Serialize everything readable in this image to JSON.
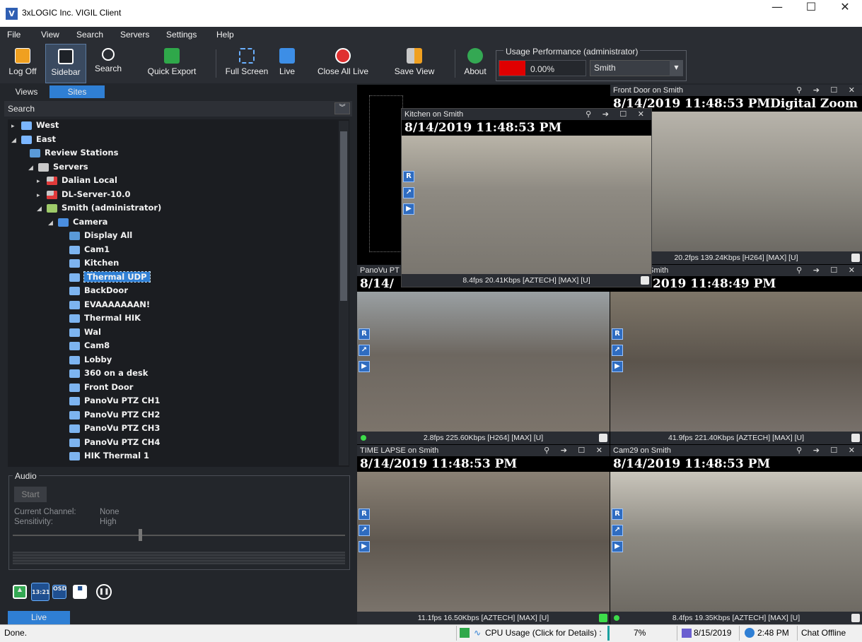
{
  "window": {
    "title": "3xLOGIC Inc. VIGIL Client",
    "icon_letter": "V",
    "minimize": "—",
    "maximize": "☐",
    "close": "✕"
  },
  "menu": [
    "File",
    "View",
    "Search",
    "Servers",
    "Settings",
    "Help"
  ],
  "toolbar": {
    "log_off": "Log Off",
    "sidebar": "Sidebar",
    "search": "Search",
    "quick_export": "Quick Export",
    "full_screen": "Full Screen",
    "live": "Live",
    "close_all_live": "Close All Live",
    "save_view": "Save View",
    "about": "About"
  },
  "usage": {
    "title": "Usage Performance (administrator)",
    "percent": "0.00%",
    "level": 0.0,
    "server": "Smith"
  },
  "left_tabs": {
    "views": "Views",
    "sites": "Sites"
  },
  "search_label": "Search",
  "tree": [
    {
      "label": "West",
      "arrow": "▸",
      "icon": "site-icon"
    },
    {
      "label": "East",
      "arrow": "◢",
      "icon": "site-icon"
    },
    {
      "label": "Review Stations",
      "arrow": "",
      "icon": "review-stations-icon"
    },
    {
      "label": "Servers",
      "arrow": "◢",
      "icon": "servers-icon"
    },
    {
      "label": "Dalian Local",
      "arrow": "▸",
      "icon": "server-offline-icon"
    },
    {
      "label": "DL-Server-10.0",
      "arrow": "▸",
      "icon": "server-offline-icon"
    },
    {
      "label": "Smith (administrator)",
      "arrow": "◢",
      "icon": "server-icon"
    },
    {
      "label": "Camera",
      "arrow": "◢",
      "icon": "camera-group-icon"
    },
    {
      "label": "Display All",
      "arrow": "",
      "icon": "display-all-icon"
    },
    {
      "label": "Cam1",
      "arrow": "",
      "icon": "camera-icon"
    },
    {
      "label": "Kitchen",
      "arrow": "",
      "icon": "camera-icon"
    },
    {
      "label": "Thermal UDP",
      "arrow": "",
      "icon": "camera-icon"
    },
    {
      "label": "BackDoor",
      "arrow": "",
      "icon": "camera-icon"
    },
    {
      "label": "EVAAAAAAAN!",
      "arrow": "",
      "icon": "camera-icon"
    },
    {
      "label": "Thermal HIK",
      "arrow": "",
      "icon": "camera-icon"
    },
    {
      "label": "Wal",
      "arrow": "",
      "icon": "camera-icon"
    },
    {
      "label": "Cam8",
      "arrow": "",
      "icon": "camera-icon"
    },
    {
      "label": "Lobby",
      "arrow": "",
      "icon": "camera-icon"
    },
    {
      "label": "360 on a desk",
      "arrow": "",
      "icon": "camera-icon"
    },
    {
      "label": "Front Door",
      "arrow": "",
      "icon": "camera-icon"
    },
    {
      "label": "PanoVu PTZ CH1",
      "arrow": "",
      "icon": "camera-icon"
    },
    {
      "label": "PanoVu PTZ CH2",
      "arrow": "",
      "icon": "camera-icon"
    },
    {
      "label": "PanoVu PTZ CH3",
      "arrow": "",
      "icon": "camera-icon"
    },
    {
      "label": "PanoVu PTZ CH4",
      "arrow": "",
      "icon": "camera-icon"
    },
    {
      "label": "HIK Thermal 1",
      "arrow": "",
      "icon": "camera-icon"
    }
  ],
  "audio": {
    "title": "Audio",
    "start": "Start",
    "current_channel_label": "Current Channel:",
    "current_channel": "None",
    "sensitivity_label": "Sensitivity:",
    "sensitivity": "High"
  },
  "bottom_icons": {
    "time": "13:21",
    "osd": "OSD"
  },
  "live_tab": "Live",
  "tiles": {
    "front_door": {
      "title": "Front Door on Smith",
      "timestamp": "8/14/2019 11:48:53 PM",
      "zoom": "Digital Zoom",
      "footer": "20.2fps 139.24Kbps [H264] [MAX] [U]"
    },
    "kitchen": {
      "title": "Kitchen on Smith",
      "timestamp": "8/14/2019 11:48:53 PM",
      "footer": "8.4fps 20.41Kbps [AZTECH] [MAX] [U]"
    },
    "panovu": {
      "title": "PanoVu PT",
      "timestamp": "8/14/",
      "footer": "2.8fps 225.60Kbps [H264] [MAX] [U]"
    },
    "ch4": {
      "title": "Z CH4 on Smith",
      "timestamp": "2019 11:48:49 PM",
      "footer": "41.9fps 221.40Kbps [AZTECH] [MAX] [U]"
    },
    "timelapse": {
      "title": "TIME LAPSE on Smith",
      "timestamp": "8/14/2019 11:48:53 PM",
      "footer": "11.1fps 16.50Kbps [AZTECH] [MAX] [U]"
    },
    "cam29": {
      "title": "Cam29 on Smith",
      "timestamp": "8/14/2019 11:48:53 PM",
      "footer": "8.4fps 19.35Kbps [AZTECH] [MAX] [U]"
    }
  },
  "status": {
    "text": "Done.",
    "cpu_label": "CPU Usage (Click for Details) :",
    "cpu_value": "7%",
    "date": "8/15/2019",
    "time": "2:48 PM",
    "chat": "Chat Offline"
  },
  "colors": {
    "accent": "#2f7fd4",
    "usage_bar": "#e00000",
    "background": "#23262b"
  }
}
